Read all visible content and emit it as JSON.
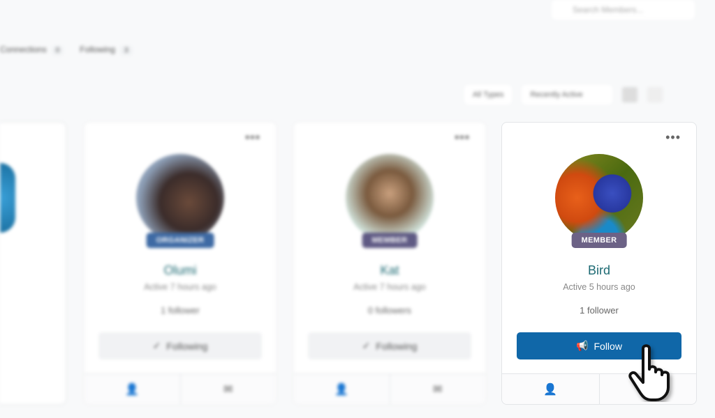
{
  "search": {
    "placeholder": "Search Members..."
  },
  "tabs": [
    {
      "label": "Connections",
      "count": "0"
    },
    {
      "label": "Following",
      "count": "3"
    }
  ],
  "filters": {
    "type": "All Types",
    "order": "Recently Active"
  },
  "cards": [
    {
      "name": "Olumi",
      "badge": "ORGANIZER",
      "badge_color": "#3e6aa4",
      "active": "Active 7 hours ago",
      "followers": "1 follower",
      "button": "Following"
    },
    {
      "name": "Kat",
      "badge": "MEMBER",
      "badge_color": "#5f5a84",
      "active": "Active 7 hours ago",
      "followers": "0 followers",
      "button": "Following"
    },
    {
      "name": "Bird",
      "badge": "MEMBER",
      "badge_color": "#6c6286",
      "active": "Active 5 hours ago",
      "followers": "1 follower",
      "button": "Follow",
      "button_color": "#1067a8"
    }
  ]
}
